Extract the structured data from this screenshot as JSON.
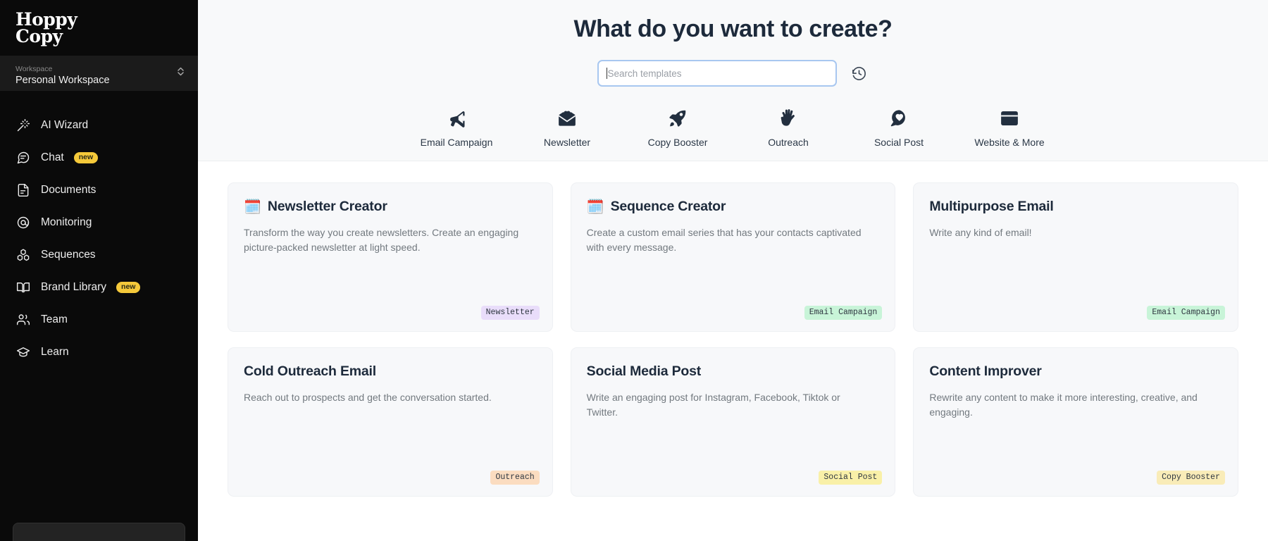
{
  "brand": {
    "line1": "Hoppy",
    "line2": "Copy"
  },
  "workspace": {
    "label": "Workspace",
    "name": "Personal Workspace",
    "chevron_icon": "chevron-up-down-icon"
  },
  "sidebar": {
    "items": [
      {
        "label": "AI Wizard",
        "icon": "magic-wand-icon",
        "badge": ""
      },
      {
        "label": "Chat",
        "icon": "chat-bubble-icon",
        "badge": "new"
      },
      {
        "label": "Documents",
        "icon": "document-icon",
        "badge": ""
      },
      {
        "label": "Monitoring",
        "icon": "at-circle-icon",
        "badge": ""
      },
      {
        "label": "Sequences",
        "icon": "blocks-icon",
        "badge": ""
      },
      {
        "label": "Brand Library",
        "icon": "open-book-icon",
        "badge": "new"
      },
      {
        "label": "Team",
        "icon": "people-icon",
        "badge": ""
      },
      {
        "label": "Learn",
        "icon": "graduation-cap-icon",
        "badge": ""
      }
    ]
  },
  "hero": {
    "title": "What do you want to create?",
    "search": {
      "placeholder": "Search templates",
      "value": ""
    },
    "history_icon": "history-clock-icon"
  },
  "categories": [
    {
      "label": "Email Campaign",
      "icon": "megaphone-icon"
    },
    {
      "label": "Newsletter",
      "icon": "envelope-heart-icon"
    },
    {
      "label": "Copy Booster",
      "icon": "rocket-icon"
    },
    {
      "label": "Outreach",
      "icon": "hand-icon"
    },
    {
      "label": "Social Post",
      "icon": "speech-bubble-heart-icon"
    },
    {
      "label": "Website & More",
      "icon": "browser-window-icon"
    }
  ],
  "tag_colors": {
    "Newsletter": "#e9ddfa",
    "Email Campaign": "#c8f4d8",
    "Outreach": "#fbdcc0",
    "Social Post": "#f9f0a8",
    "Copy Booster": "#f9ecb8"
  },
  "cards": [
    {
      "emoji": "🗓️",
      "title": "Newsletter Creator",
      "desc": "Transform the way you create newsletters. Create an engaging picture-packed newsletter at light speed.",
      "tag": "Newsletter"
    },
    {
      "emoji": "🗓️",
      "title": "Sequence Creator",
      "desc": "Create a custom email series that has your contacts captivated with every message.",
      "tag": "Email Campaign"
    },
    {
      "emoji": "",
      "title": "Multipurpose Email",
      "desc": "Write any kind of email!",
      "tag": "Email Campaign"
    },
    {
      "emoji": "",
      "title": "Cold Outreach Email",
      "desc": "Reach out to prospects and get the conversation started.",
      "tag": "Outreach"
    },
    {
      "emoji": "",
      "title": "Social Media Post",
      "desc": "Write an engaging post for Instagram, Facebook, Tiktok or Twitter.",
      "tag": "Social Post"
    },
    {
      "emoji": "",
      "title": "Content Improver",
      "desc": "Rewrite any content to make it more interesting, creative, and engaging.",
      "tag": "Copy Booster"
    }
  ]
}
